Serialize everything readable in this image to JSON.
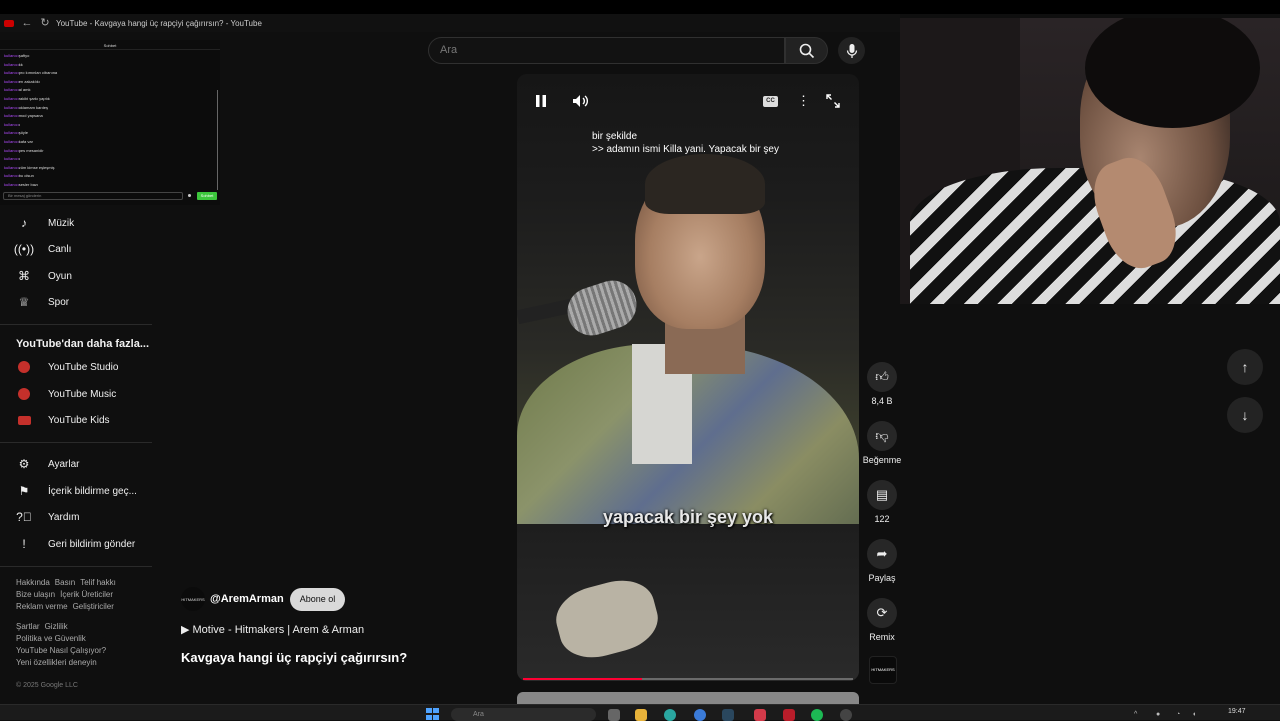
{
  "browser": {
    "tab_title": "YouTube - Kavgaya hangi üç rapçiyi çağırırsın? - YouTube"
  },
  "chat": {
    "title": "Sohbet",
    "messages": [
      {
        "user": "kullanıcı",
        "text": "şaftyo"
      },
      {
        "user": "kullanıcı",
        "text": "kk"
      },
      {
        "user": "kullanıcı",
        "text": "pro kımınları cibanına"
      },
      {
        "user": "kullanıcı",
        "text": "en zakaklıkı"
      },
      {
        "user": "kullanıcı",
        "text": "al amk"
      },
      {
        "user": "kullanıcı",
        "text": "rakibi şarkı yaptık"
      },
      {
        "user": "kullanıcı",
        "text": "oklamam kardeş"
      },
      {
        "user": "kullanıcı",
        "text": "mod yapsana"
      },
      {
        "user": "kullanıcı",
        "text": "•"
      },
      {
        "user": "kullanıcı",
        "text": "şöyle"
      },
      {
        "user": "kullanıcı",
        "text": "kafa var"
      },
      {
        "user": "kullanıcı",
        "text": "pes mesanidir"
      },
      {
        "user": "kullanıcı",
        "text": "•"
      },
      {
        "user": "kullanıcı",
        "text": "züm kimse eşleşmiş"
      },
      {
        "user": "kullanıcı",
        "text": "bu olsun"
      },
      {
        "user": "kullanıcı",
        "text": "sesler bazı"
      }
    ],
    "input_placeholder": "Bir mesaj gönderin",
    "send_label": "Sohbet"
  },
  "sidebar": {
    "items": [
      {
        "label": "Müzik",
        "icon": "music-note-icon"
      },
      {
        "label": "Canlı",
        "icon": "live-icon"
      },
      {
        "label": "Oyun",
        "icon": "gamepad-icon"
      },
      {
        "label": "Spor",
        "icon": "trophy-icon"
      }
    ],
    "more_title": "YouTube'dan daha fazla...",
    "more_items": [
      {
        "label": "YouTube Studio"
      },
      {
        "label": "YouTube Music"
      },
      {
        "label": "YouTube Kids"
      }
    ],
    "settings_items": [
      {
        "label": "Ayarlar",
        "icon": "gear-icon"
      },
      {
        "label": "İçerik bildirme geç...",
        "icon": "flag-icon"
      },
      {
        "label": "Yardım",
        "icon": "help-icon"
      },
      {
        "label": "Geri bildirim gönder",
        "icon": "feedback-icon"
      }
    ],
    "footer_line1": [
      "Hakkında",
      "Basın",
      "Telif hakkı"
    ],
    "footer_line2": [
      "Bize ulaşın",
      "İçerik Üreticiler"
    ],
    "footer_line3": [
      "Reklam verme",
      "Geliştiriciler"
    ],
    "footer_line4": [
      "Şartlar",
      "Gizlilik"
    ],
    "footer_line5": "Politika ve Güvenlik",
    "footer_line6": "YouTube Nasıl Çalışıyor?",
    "footer_line7": "Yeni özellikleri deneyin",
    "copyright": "© 2025 Google LLC"
  },
  "search": {
    "placeholder": "Ara"
  },
  "video": {
    "caption_line1": "bir şekilde",
    "caption_line2": ">> adamın ismi Killa yani. Yapacak bir şey",
    "burned_subtitle": "yapacak bir şey yok",
    "progress": 0.36
  },
  "actions": {
    "like_count": "8,4 B",
    "dislike_label": "Beğenme",
    "comment_count": "122",
    "share_label": "Paylaş",
    "remix_label": "Remix",
    "channel_thumb_text": "HITMAKERS"
  },
  "meta": {
    "avatar_text": "HITMAKERS",
    "handle": "@AremArman",
    "subscribe_label": "Abone ol",
    "music": "▶  Motive - Hitmakers | Arem & Arman",
    "title": "Kavgaya hangi üç rapçiyi çağırırsın?"
  },
  "taskbar": {
    "search_placeholder": "Ara",
    "time": "19:47"
  }
}
